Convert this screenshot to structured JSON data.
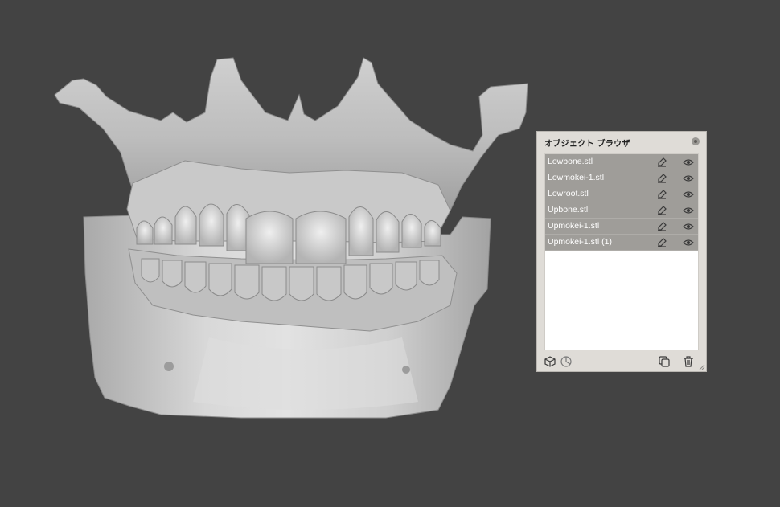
{
  "viewport": {
    "background_color": "#434343",
    "model_color": "#d6d6d6",
    "model_description_icon": "dental-jaw-3d-model"
  },
  "object_browser": {
    "title": "オブジェクト ブラウザ",
    "items": [
      {
        "label": "Lowbone.stl",
        "visible": true
      },
      {
        "label": "Lowmokei-1.stl",
        "visible": true
      },
      {
        "label": "Lowroot.stl",
        "visible": true
      },
      {
        "label": "Upbone.stl",
        "visible": true
      },
      {
        "label": "Upmokei-1.stl",
        "visible": true
      },
      {
        "label": "Upmokei-1.stl (1)",
        "visible": true
      }
    ],
    "row_selected_color": "#9f9d99",
    "icons": {
      "close": "close-icon",
      "edit": "edit-icon",
      "visibility": "eye-icon",
      "add_object": "cube-icon",
      "color": "color-icon",
      "duplicate": "duplicate-icon",
      "delete": "trash-icon"
    }
  }
}
